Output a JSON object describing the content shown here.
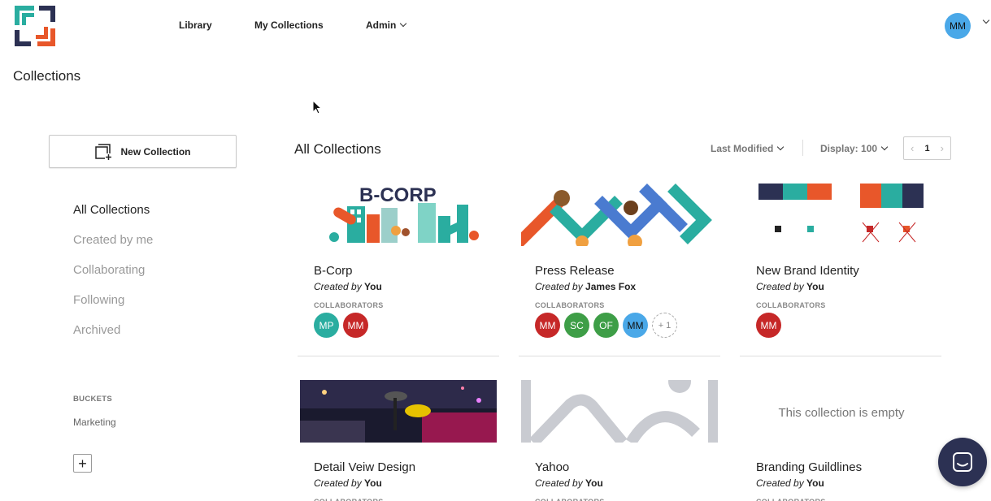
{
  "header": {
    "nav": [
      {
        "label": "Library"
      },
      {
        "label": "My Collections"
      },
      {
        "label": "Admin"
      }
    ],
    "user_initials": "MM"
  },
  "page_title": "Collections",
  "sidebar": {
    "new_collection_label": "New Collection",
    "items": [
      {
        "label": "All Collections",
        "active": true
      },
      {
        "label": "Created by me",
        "active": false
      },
      {
        "label": "Collaborating",
        "active": false
      },
      {
        "label": "Following",
        "active": false
      },
      {
        "label": "Archived",
        "active": false
      }
    ],
    "buckets_heading": "BUCKETS",
    "buckets": [
      {
        "label": "Marketing"
      }
    ],
    "add_bucket_symbol": "+"
  },
  "main": {
    "title": "All Collections",
    "sort_label": "Last Modified",
    "display_label": "Display: 100",
    "page_number": "1",
    "collaborators_heading": "COLLABORATORS",
    "created_by_label": "Created by",
    "cards": [
      {
        "title": "B-Corp",
        "creator": "You",
        "thumb_text": "B-CORP",
        "collaborators": [
          {
            "initials": "MP",
            "color": "#2aada0"
          },
          {
            "initials": "MM",
            "color": "#c62828"
          }
        ]
      },
      {
        "title": "Press Release",
        "creator": "James Fox",
        "collaborators": [
          {
            "initials": "MM",
            "color": "#c62828"
          },
          {
            "initials": "SC",
            "color": "#3e9e47"
          },
          {
            "initials": "OF",
            "color": "#3e9e47"
          },
          {
            "initials": "MM",
            "color": "#4aa8e8"
          }
        ],
        "more_count": "+ 1"
      },
      {
        "title": "New Brand Identity",
        "creator": "You",
        "collaborators": [
          {
            "initials": "MM",
            "color": "#c62828"
          }
        ]
      },
      {
        "title": "Detail Veiw Design",
        "creator": "You"
      },
      {
        "title": "Yahoo",
        "creator": "You"
      },
      {
        "title": "Branding Guildlines",
        "creator": "You",
        "empty_text": "This collection is empty"
      }
    ]
  },
  "colors": {
    "brand_teal": "#2aada0",
    "brand_orange": "#e8572a",
    "brand_navy": "#2c3153",
    "muted": "#999999"
  }
}
